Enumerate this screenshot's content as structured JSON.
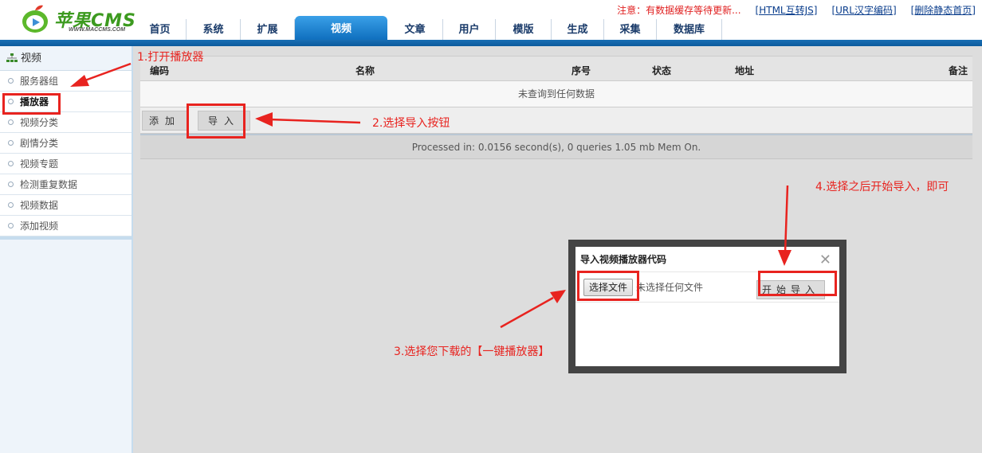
{
  "header": {
    "logo_text": "苹果CMS",
    "logo_sub": "WWW.MACCMS.COM",
    "notice": "注意：有数据缓存等待更新...",
    "links": [
      "[HTML互转JS]",
      "[URL汉字编码]",
      "[删除静态首页]"
    ],
    "nav": [
      "首页",
      "系统",
      "扩展",
      "视频",
      "文章",
      "用户",
      "模版",
      "生成",
      "采集",
      "数据库"
    ],
    "active_nav": "视频"
  },
  "sidebar": {
    "title": "视频",
    "items": [
      "服务器组",
      "播放器",
      "视频分类",
      "剧情分类",
      "视频专题",
      "检测重复数据",
      "视频数据",
      "添加视频"
    ],
    "active_item": "播放器"
  },
  "table": {
    "columns": [
      "编码",
      "名称",
      "序号",
      "状态",
      "地址",
      "备注"
    ],
    "empty_text": "未查询到任何数据",
    "add_button": "添加",
    "import_button": "导入",
    "footer": "Processed in: 0.0156 second(s), 0 queries 1.05 mb Mem On."
  },
  "dialog": {
    "title": "导入视频播放器代码",
    "close_symbol": "✕",
    "choose_file_button": "选择文件",
    "file_status": "未选择任何文件",
    "start_button": "开始导入"
  },
  "annotations": {
    "step1": "1.打开播放器",
    "step2": "2.选择导入按钮",
    "step3": "3.选择您下载的【一键播放器】",
    "step4": "4.选择之后开始导入，即可",
    "color": "#e8231f"
  }
}
